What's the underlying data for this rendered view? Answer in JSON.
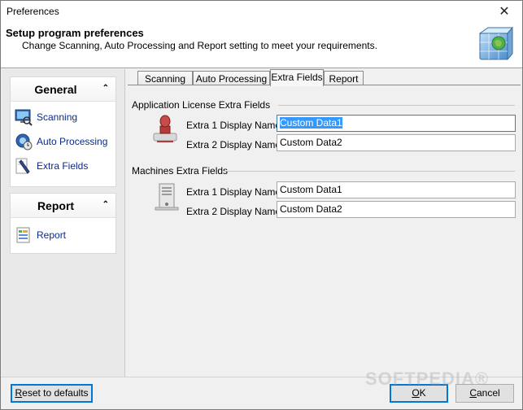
{
  "window": {
    "title": "Preferences",
    "close_glyph": "✕"
  },
  "header": {
    "title": "Setup program preferences",
    "subtitle": "Change Scanning, Auto Processing and Report setting to meet your requirements.",
    "icon": "globe-box-icon"
  },
  "sidebar": {
    "panels": [
      {
        "title": "General",
        "chevron": "⌃",
        "items": [
          {
            "label": "Scanning",
            "icon": "scanning-monitor-icon"
          },
          {
            "label": "Auto Processing",
            "icon": "auto-processing-icon"
          },
          {
            "label": "Extra Fields",
            "icon": "extra-fields-pencil-icon"
          }
        ]
      },
      {
        "title": "Report",
        "chevron": "⌃",
        "items": [
          {
            "label": "Report",
            "icon": "report-document-icon"
          }
        ]
      }
    ]
  },
  "tabs": [
    {
      "label": "Scanning",
      "active": false
    },
    {
      "label": "Auto Processing",
      "active": false
    },
    {
      "label": "Extra Fields",
      "active": true
    },
    {
      "label": "Report",
      "active": false
    }
  ],
  "extra_fields": {
    "application_group": {
      "title": "Application License Extra Fields",
      "icon": "license-stamp-icon",
      "field1_label": "Extra 1 Display Name:",
      "field1_value": "Custom Data1",
      "field2_label": "Extra 2 Display Name:",
      "field2_value": "Custom Data2"
    },
    "machines_group": {
      "title": "Machines Extra Fields",
      "icon": "machine-tower-icon",
      "field1_label": "Extra 1 Display Name:",
      "field1_value": "Custom Data1",
      "field2_label": "Extra 2 Display Name:",
      "field2_value": "Custom Data2"
    }
  },
  "footer": {
    "reset_first": "R",
    "reset_rest": "eset to defaults",
    "ok_first": "O",
    "ok_rest": "K",
    "cancel_first": "C",
    "cancel_rest": "ancel"
  },
  "watermark": "SOFTPEDIA®",
  "colors": {
    "accent": "#0078d7",
    "selection": "#3399ff",
    "link": "#0a2a8a"
  }
}
